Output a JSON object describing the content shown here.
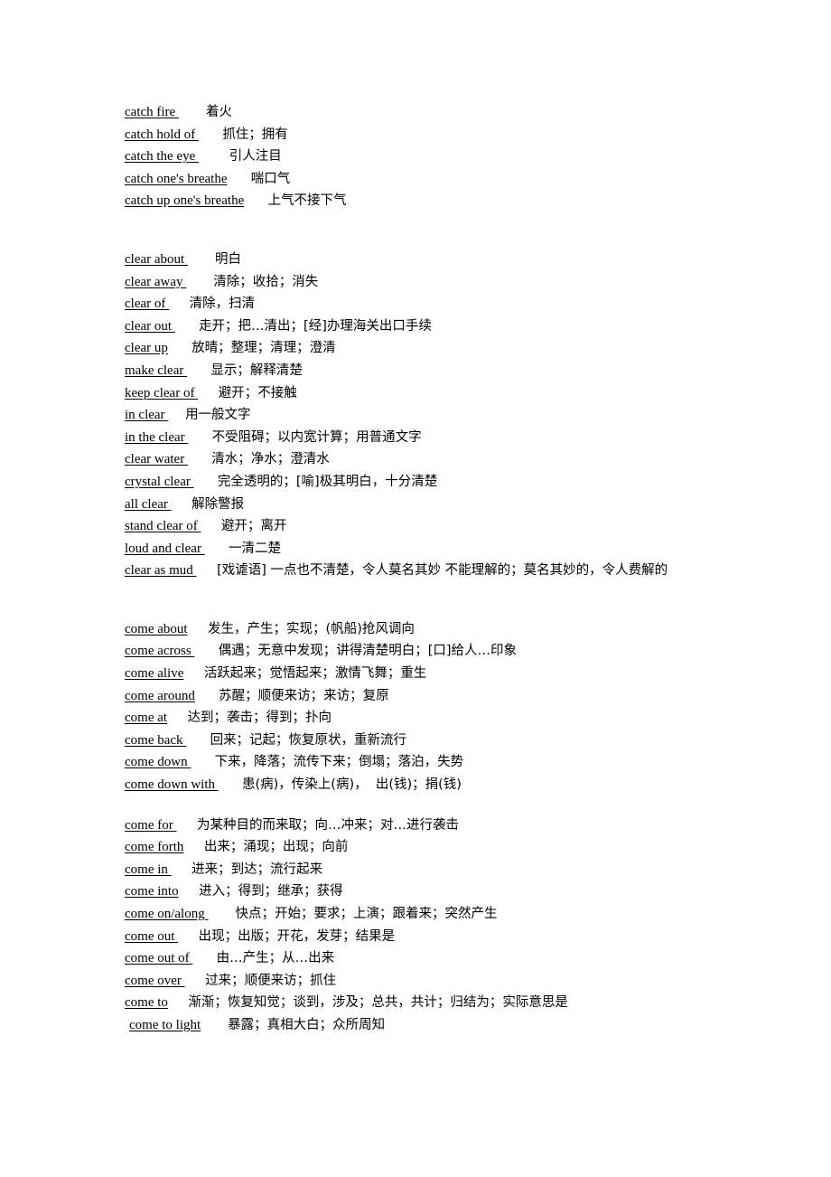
{
  "document": {
    "type": "vocabulary-phrase-list",
    "language_pair": "English-Chinese",
    "blocks": [
      {
        "id": "catch",
        "headword": "catch",
        "entries": [
          {
            "term": "catch fire ",
            "gap": "        ",
            "definition": "着火"
          },
          {
            "term": "catch hold of ",
            "gap": "       ",
            "definition": "抓住；拥有"
          },
          {
            "term": "catch the eye ",
            "gap": "         ",
            "definition": "引人注目"
          },
          {
            "term": "catch one's breathe",
            "gap": "       ",
            "definition": "喘口气"
          },
          {
            "term": "catch up one's breathe",
            "gap": "       ",
            "definition": "上气不接下气"
          }
        ]
      },
      {
        "id": "clear",
        "headword": "clear",
        "entries": [
          {
            "term": "clear about ",
            "gap": "        ",
            "definition": "明白"
          },
          {
            "term": "clear away ",
            "gap": "        ",
            "definition": "清除；收拾；消失"
          },
          {
            "term": "clear of ",
            "gap": "      ",
            "definition": "清除，扫清"
          },
          {
            "term": "clear out ",
            "gap": "       ",
            "definition": "走开；把…清出；[经]办理海关出口手续"
          },
          {
            "term": "clear up",
            "gap": "       ",
            "definition": "放晴；整理；清理；澄清"
          },
          {
            "term": "make clear ",
            "gap": "       ",
            "definition": "显示；解释清楚"
          },
          {
            "term": "keep clear of ",
            "gap": "      ",
            "definition": "避开；不接触"
          },
          {
            "term": "in clear ",
            "gap": "     ",
            "definition": "用一般文字"
          },
          {
            "term": "in the clear ",
            "gap": "       ",
            "definition": "不受阻碍；以内宽计算；用普通文字"
          },
          {
            "term": "clear water ",
            "gap": "       ",
            "definition": "清水；净水；澄清水"
          },
          {
            "term": "crystal clear ",
            "gap": "       ",
            "definition": "完全透明的；[喻]极其明白，十分清楚"
          },
          {
            "term": "all clear ",
            "gap": "      ",
            "definition": "解除警报"
          },
          {
            "term": "stand clear of ",
            "gap": "      ",
            "definition": "避开；离开"
          },
          {
            "term": "loud and clear ",
            "gap": "       ",
            "definition": "一清二楚"
          },
          {
            "term": "clear as mud ",
            "gap": "      ",
            "definition": "[戏谑语] 一点也不清楚，令人莫名其妙 不能理解的；莫名其妙的，令人费解的"
          }
        ]
      },
      {
        "id": "come-1",
        "headword": "come",
        "entries": [
          {
            "term": "come about",
            "gap": "      ",
            "definition": "发生，产生；实现；(帆船)抢风调向"
          },
          {
            "term": "come across ",
            "gap": "       ",
            "definition": "偶遇；无意中发现；讲得清楚明白；[口]给人…印象"
          },
          {
            "term": "come alive",
            "gap": "      ",
            "definition": "活跃起来；觉悟起来；激情飞舞；重生"
          },
          {
            "term": "come around",
            "gap": "       ",
            "definition": "苏醒；顺便来访；来访；复原"
          },
          {
            "term": "come at",
            "gap": "      ",
            "definition": "达到；袭击；得到；扑向"
          },
          {
            "term": "come back ",
            "gap": "       ",
            "definition": "回来；记起；恢复原状，重新流行"
          },
          {
            "term": "come down ",
            "gap": "       ",
            "definition": "下来，降落；流传下来；倒塌；落泊，失势"
          },
          {
            "term": "come down with ",
            "gap": "       ",
            "definition": "患(病)，传染上(病)，  出(钱)；捐(钱)"
          }
        ]
      },
      {
        "id": "come-2",
        "headword": "come",
        "entries": [
          {
            "term": "come for ",
            "gap": "      ",
            "definition": "为某种目的而来取；向…冲来；对…进行袭击"
          },
          {
            "term": "come forth",
            "gap": "      ",
            "definition": "出来；涌现；出现；向前"
          },
          {
            "term": "come in ",
            "gap": "      ",
            "definition": "进来；到达；流行起来"
          },
          {
            "term": "come into",
            "gap": "      ",
            "definition": "进入；得到；继承；获得"
          },
          {
            "term": "come on/along ",
            "gap": "        ",
            "definition": "快点；开始；要求；上演；跟着来；突然产生"
          },
          {
            "term": "come out ",
            "gap": "      ",
            "definition": "出现；出版；开花，发芽；结果是"
          },
          {
            "term": "come out of ",
            "gap": "       ",
            "definition": "由…产生；从…出来"
          },
          {
            "term": "come over ",
            "gap": "      ",
            "definition": "过来；顺便来访；抓住"
          },
          {
            "term": "come to",
            "gap": "      ",
            "definition": "渐渐；恢复知觉；谈到，涉及；总共，共计；归结为；实际意思是"
          },
          {
            "term": "come to light",
            "gap": "        ",
            "definition": "暴露；真相大白；众所周知",
            "indented": true
          }
        ]
      }
    ]
  }
}
